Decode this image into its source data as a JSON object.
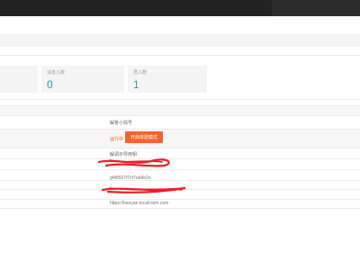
{
  "stats": [
    {
      "label": "",
      "value": ""
    },
    {
      "label": "消息入数",
      "value": "0"
    },
    {
      "label": "员入数",
      "value": "1"
    }
  ],
  "info": {
    "name_label": "解答小情号",
    "status_text": "运行中",
    "mode_button_label": "开启体验模式",
    "secret_label": "解调示导用钥",
    "secret_value": "g4f8507f7cf7ab8e2e",
    "url_value": "https://banyan.localroom.com"
  },
  "colors": {
    "accent": "#f3642b",
    "stat_value": "#2a9fa8",
    "redaction": "#e8202a"
  }
}
